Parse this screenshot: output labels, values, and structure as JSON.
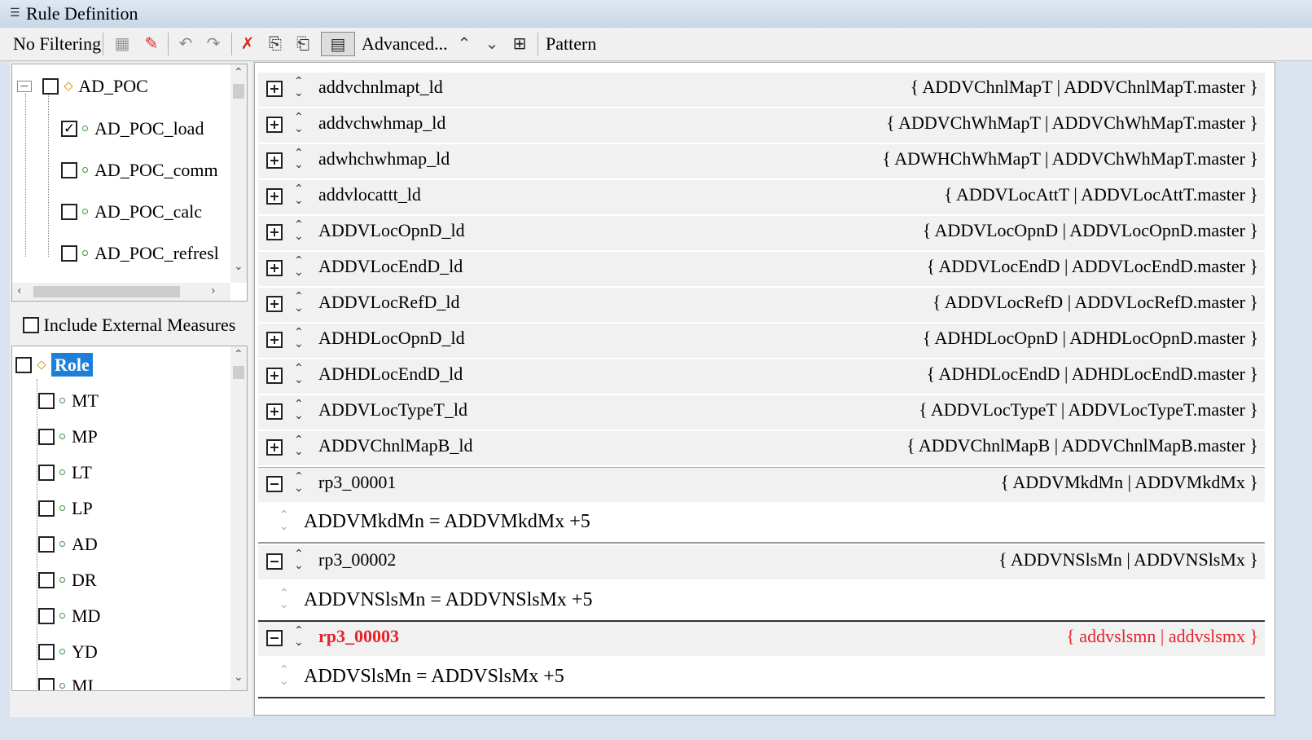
{
  "window": {
    "title": "Rule Definition"
  },
  "toolbar": {
    "filter_label": "No Filtering",
    "advanced_label": "Advanced...",
    "pattern_label": "Pattern"
  },
  "tree": {
    "root": "AD_POC",
    "children": [
      {
        "label": "AD_POC_load",
        "checked": true
      },
      {
        "label": "AD_POC_comm",
        "checked": false
      },
      {
        "label": "AD_POC_calc",
        "checked": false
      },
      {
        "label": "AD_POC_refresl",
        "checked": false
      }
    ]
  },
  "include_external_label": "Include External Measures",
  "dimension_tree": {
    "root": "Role",
    "items": [
      "MT",
      "MP",
      "LT",
      "LP",
      "AD",
      "DR",
      "MD",
      "YD",
      "MI"
    ]
  },
  "rules": [
    {
      "name": "addvchnlmapt_ld",
      "measures": "{ ADDVChnlMapT | ADDVChnlMapT.master }",
      "expanded": false
    },
    {
      "name": "addvchwhmap_ld",
      "measures": "{ ADDVChWhMapT | ADDVChWhMapT.master }",
      "expanded": false
    },
    {
      "name": "adwhchwhmap_ld",
      "measures": "{ ADWHChWhMapT | ADDVChWhMapT.master }",
      "expanded": false
    },
    {
      "name": "addvlocattt_ld",
      "measures": "{ ADDVLocAttT | ADDVLocAttT.master }",
      "expanded": false
    },
    {
      "name": "ADDVLocOpnD_ld",
      "measures": "{ ADDVLocOpnD | ADDVLocOpnD.master }",
      "expanded": false
    },
    {
      "name": "ADDVLocEndD_ld",
      "measures": "{ ADDVLocEndD | ADDVLocEndD.master }",
      "expanded": false
    },
    {
      "name": "ADDVLocRefD_ld",
      "measures": "{ ADDVLocRefD | ADDVLocRefD.master }",
      "expanded": false
    },
    {
      "name": "ADHDLocOpnD_ld",
      "measures": "{ ADHDLocOpnD | ADHDLocOpnD.master }",
      "expanded": false
    },
    {
      "name": "ADHDLocEndD_ld",
      "measures": "{ ADHDLocEndD | ADHDLocEndD.master }",
      "expanded": false
    },
    {
      "name": "ADDVLocTypeT_ld",
      "measures": "{ ADDVLocTypeT | ADDVLocTypeT.master }",
      "expanded": false
    },
    {
      "name": "ADDVChnlMapB_ld",
      "measures": "{ ADDVChnlMapB | ADDVChnlMapB.master }",
      "expanded": false
    },
    {
      "name": "rp3_00001",
      "measures": "{ ADDVMkdMn | ADDVMkdMx }",
      "expanded": true,
      "expression": "ADDVMkdMn = ADDVMkdMx +5"
    },
    {
      "name": "rp3_00002",
      "measures": "{ ADDVNSlsMn | ADDVNSlsMx }",
      "expanded": true,
      "expression": "ADDVNSlsMn = ADDVNSlsMx +5"
    },
    {
      "name": "rp3_00003",
      "measures": "{ addvslsmn | addvslsmx }",
      "expanded": true,
      "expression": "ADDVSlsMn = ADDVSlsMx +5",
      "error": true
    }
  ],
  "colors": {
    "selection": "#1e7fd8",
    "error": "#e8232a",
    "titlebar": "#c9d6e6"
  }
}
